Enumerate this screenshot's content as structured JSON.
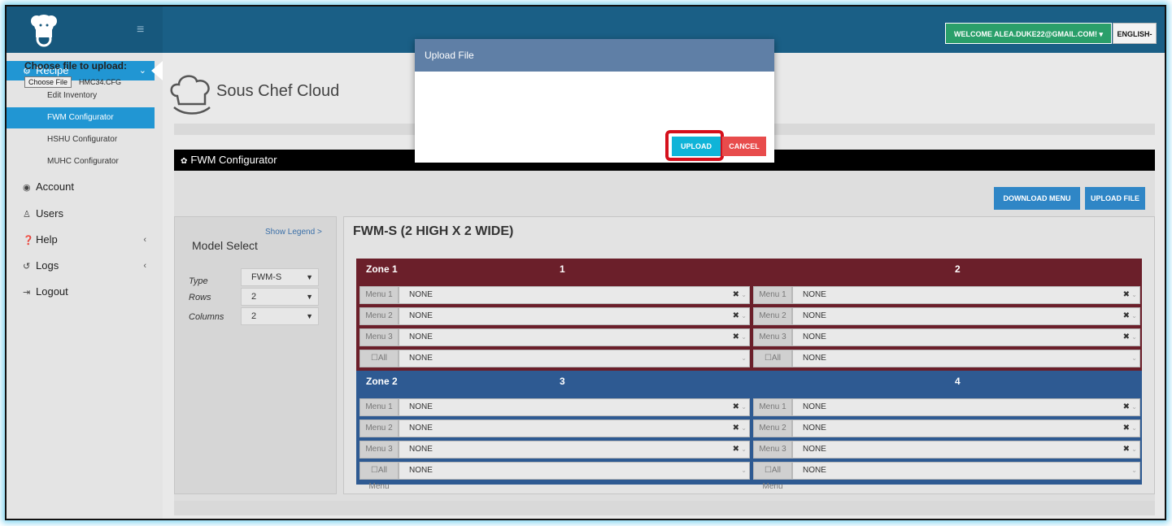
{
  "header": {
    "welcome": "WELCOME ALEA.DUKE22@GMAIL.COM! ▾",
    "language": "ENGLISH-"
  },
  "sidebar": {
    "recipe": "Recipe",
    "sub_items": [
      "Edit Inventory",
      "FWM Configurator",
      "HSHU Configurator",
      "MUHC Configurator"
    ],
    "account": "Account",
    "users": "Users",
    "help": "Help",
    "logs": "Logs",
    "logout": "Logout"
  },
  "brand": {
    "name": "Sous Chef Cloud"
  },
  "section": {
    "title": "FWM Configurator"
  },
  "actions": {
    "download_menu": "DOWNLOAD MENU",
    "upload_file": "UPLOAD FILE"
  },
  "model_select": {
    "legend_link": "Show Legend >",
    "title": "Model Select",
    "type_label": "Type",
    "type_value": "FWM-S",
    "rows_label": "Rows",
    "rows_value": "2",
    "columns_label": "Columns",
    "columns_value": "2"
  },
  "config": {
    "title": "FWM-S (2 HIGH X 2 WIDE)",
    "zones": [
      {
        "label": "Zone 1",
        "col_left": "1",
        "col_right": "2",
        "rows": [
          {
            "label": "Menu 1",
            "value": "NONE"
          },
          {
            "label": "Menu 2",
            "value": "NONE"
          },
          {
            "label": "Menu 3",
            "value": "NONE"
          },
          {
            "label": "☐All Menu",
            "value": "NONE"
          }
        ]
      },
      {
        "label": "Zone 2",
        "col_left": "3",
        "col_right": "4",
        "rows": [
          {
            "label": "Menu 1",
            "value": "NONE"
          },
          {
            "label": "Menu 2",
            "value": "NONE"
          },
          {
            "label": "Menu 3",
            "value": "NONE"
          },
          {
            "label": "☐All Menu",
            "value": "NONE"
          }
        ]
      }
    ]
  },
  "modal": {
    "title": "Upload File",
    "prompt": "Choose file to upload:",
    "choose_button": "Choose File",
    "file_name": "HMC34.CFG",
    "upload": "UPLOAD",
    "cancel": "CANCEL"
  },
  "colors": {
    "zone1": "#6b1f2a",
    "zone2": "#2e5a92",
    "highlight": "#d5101c"
  }
}
